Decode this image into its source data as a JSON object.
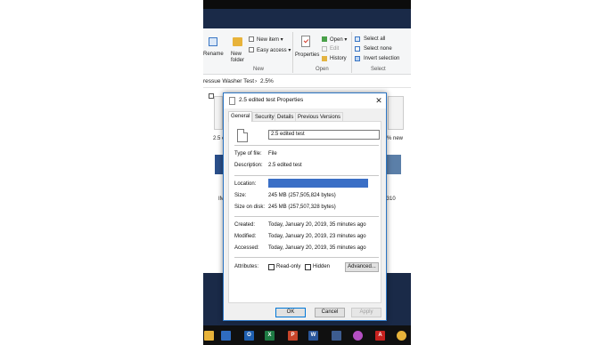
{
  "explorer": {
    "ribbon": {
      "rename_label": "Rename",
      "new_folder_label": "New\nfolder",
      "new_item_label": "New item ▾",
      "easy_access_label": "Easy access ▾",
      "new_group_label": "New",
      "properties_label": "Properties",
      "open_label": "Open ▾",
      "edit_label": "Edit",
      "history_label": "History",
      "open_group_label": "Open",
      "select_all_label": "Select all",
      "select_none_label": "Select none",
      "invert_selection_label": "Invert selection",
      "select_group_label": "Select"
    },
    "address": {
      "segment1": "ressue Washer Test",
      "separator": "›",
      "segment2": "2.5%"
    },
    "items": {
      "item1_label": "2.5 e",
      "item2_label": "% new",
      "item3_label": "IM",
      "item4_label": "_6310"
    }
  },
  "dialog": {
    "title": "2.5 edited test Properties",
    "close_glyph": "✕",
    "tabs": [
      "General",
      "Security",
      "Details",
      "Previous Versions"
    ],
    "file_name": "2.5 edited test",
    "type_of_file_label": "Type of file:",
    "type_of_file_value": "File",
    "description_label": "Description:",
    "description_value": "2.5 edited test",
    "location_label": "Location:",
    "size_label": "Size:",
    "size_value": "245 MB (257,505,824 bytes)",
    "size_on_disk_label": "Size on disk:",
    "size_on_disk_value": "245 MB (257,507,328 bytes)",
    "created_label": "Created:",
    "created_value": "Today, January 20, 2019, 35 minutes ago",
    "modified_label": "Modified:",
    "modified_value": "Today, January 20, 2019, 23 minutes ago",
    "accessed_label": "Accessed:",
    "accessed_value": "Today, January 20, 2019, 35 minutes ago",
    "attributes_label": "Attributes:",
    "readonly_label": "Read-only",
    "hidden_label": "Hidden",
    "advanced_label": "Advanced...",
    "ok_label": "OK",
    "cancel_label": "Cancel",
    "apply_label": "Apply"
  },
  "taskbar": {
    "icons": [
      "folder-icon",
      "store-icon",
      "outlook-icon",
      "excel-icon",
      "powerpoint-icon",
      "word-icon",
      "photos-icon",
      "paint-icon",
      "acrobat-icon",
      "chrome-icon"
    ],
    "colors": {
      "accent": "#0078d7",
      "location_bar": "#3a6fc6"
    }
  }
}
